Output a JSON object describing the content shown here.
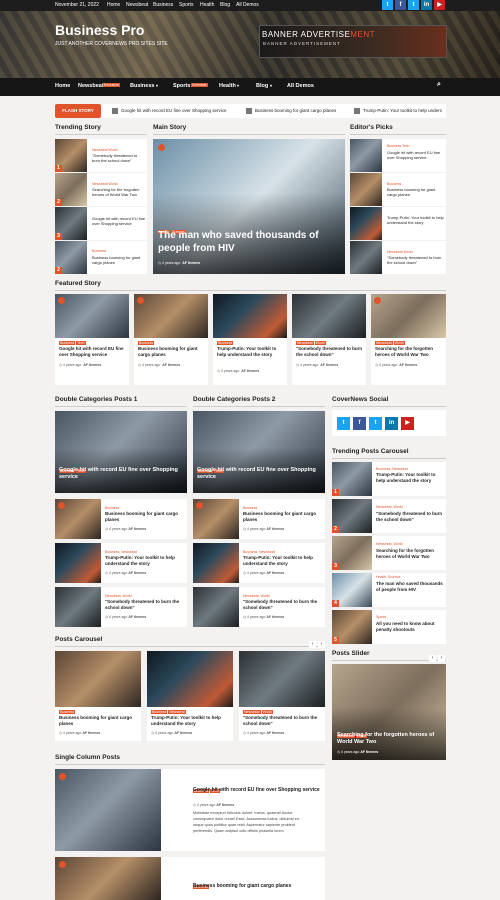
{
  "topbar": {
    "date": "November 21, 2022",
    "links": [
      "Home",
      "Newsbeat",
      "Business",
      "Sports",
      "Health",
      "Blog",
      "All Demos"
    ],
    "social_colors": {
      "twitter": "#1da1f2",
      "facebook": "#3b5998",
      "linkedin": "#0e76a8",
      "youtube": "#cd201f"
    }
  },
  "header": {
    "title": "Business Pro",
    "tagline": "JUST ANOTHER COVERNEWS PRO SITES SITE",
    "banner_main": "BANNER ADVERTISE",
    "banner_accent": "MENT",
    "banner_sub": "BANNER ADVERTISEMENT"
  },
  "nav": {
    "items": [
      "Home",
      "Newsbeat",
      "Business",
      "Sports",
      "Health",
      "Blog",
      "All Demos"
    ],
    "badge_newsbeat": "Exclusive",
    "badge_sports": "Schedule"
  },
  "flash": {
    "label": "FLASH STORY",
    "items": [
      "Google hit with record EU fine over Shopping service",
      "Business booming for giant cargo planes",
      "Trump-Putin: Your toolkit to help unders"
    ]
  },
  "sections": {
    "trending": "Trending Story",
    "main": "Main Story",
    "editors": "Editor's Picks",
    "featured": "Featured Story",
    "dbl1": "Double Categories Posts 1",
    "dbl2": "Double Categories Posts 2",
    "social": "CoverNews Social",
    "trend_car": "Trending Posts Carousel",
    "posts_car": "Posts Carousel",
    "slider": "Posts Slider",
    "single": "Single Column Posts"
  },
  "accent": "#e0532b",
  "meta": {
    "time": "4 years ago",
    "author": "AF themes"
  },
  "trending": [
    {
      "cat": "Newsbeat World",
      "title": "\"Somebody threatened to burn the school down\"",
      "n": "1"
    },
    {
      "cat": "Newsbeat World",
      "title": "Searching for the forgotten heroes of World War Two",
      "n": "2"
    },
    {
      "cat": "",
      "title": "Google hit with record EU fine over Shopping service",
      "n": "3"
    },
    {
      "cat": "Business",
      "title": "Business booming for giant cargo planes",
      "n": "2"
    }
  ],
  "mainstory": {
    "cats": [
      "Health",
      "Science"
    ],
    "title": "The man who saved thousands of people from HIV"
  },
  "editors": [
    {
      "cat": "Business Tech",
      "title": "Google hit with record EU fine over Shopping service"
    },
    {
      "cat": "Business",
      "title": "Business booming for giant cargo planes"
    },
    {
      "cat": "",
      "title": "Trump-Putin: Your toolkit to help understand the story"
    },
    {
      "cat": "Newsbeat World",
      "title": "\"Somebody threatened to burn the school down\""
    }
  ],
  "featured": [
    {
      "cats": [
        "Business",
        "Tech"
      ],
      "title": "Google hit with record EU fine over Shopping service"
    },
    {
      "cats": [
        "Business"
      ],
      "title": "Business booming for giant cargo planes"
    },
    {
      "cats": [
        "Business"
      ],
      "title": "Trump-Putin: Your toolkit to help understand the story"
    },
    {
      "cats": [
        "Newsbeat",
        "World"
      ],
      "title": "\"Somebody threatened to burn the school down\""
    },
    {
      "cats": [
        "Newsbeat",
        "World"
      ],
      "title": "Searching for the forgotten heroes of World War Two"
    }
  ],
  "dbl": {
    "lead_cats": [
      "Business",
      "Tech"
    ],
    "lead_title": "Google hit with record EU fine over Shopping service",
    "items": [
      {
        "cat": "Business",
        "title": "Business booming for giant cargo planes"
      },
      {
        "cat": "Business, Newsbeat",
        "title": "Trump-Putin: Your toolkit to help understand the story"
      },
      {
        "cat": "Newsbeat, World",
        "title": "\"Somebody threatened to burn the school down\""
      }
    ]
  },
  "trend_car": [
    {
      "cat": "Business, Newsbeat",
      "title": "Trump-Putin: Your toolkit to help understand the story"
    },
    {
      "cat": "Newsbeat, World",
      "title": "\"Somebody threatened to burn the school down\""
    },
    {
      "cat": "Newsbeat, World",
      "title": "Searching for the forgotten heroes of World War Two"
    },
    {
      "cat": "Health, Science",
      "title": "The man who saved thousands of people from HIV"
    },
    {
      "cat": "Sports",
      "title": "All you need to know about penalty shootouts"
    }
  ],
  "posts_car": [
    {
      "cats": [
        "Business"
      ],
      "title": "Business booming for giant cargo planes"
    },
    {
      "cats": [
        "Business",
        "Newsbeat"
      ],
      "title": "Trump-Putin: Your toolkit to help understand the story"
    },
    {
      "cats": [
        "Newsbeat",
        "World"
      ],
      "title": "\"Somebody threatened to burn the school down\""
    }
  ],
  "slider": {
    "cats": [
      "Newsbeat",
      "World"
    ],
    "title": "Searching for the forgotten heroes of World War Two"
  },
  "single": [
    {
      "cats": [
        "Business",
        "Tech"
      ],
      "title": "Google hit with record EU fine over Shopping service",
      "excerpt": [
        "Molestiae excepturi ridiculus dolore, metus, quaerat! Auctor",
        "consequatur dolor curae! Esse. Assumenda luctus, dictumst eu",
        "neque quos porttitor quae reici! Aspernatur sapiente proident",
        "perferendis. Quam adipisci odio officiis phasella lorem"
      ]
    },
    {
      "cats": [
        "Business"
      ],
      "title": "Business booming for giant cargo planes"
    }
  ]
}
